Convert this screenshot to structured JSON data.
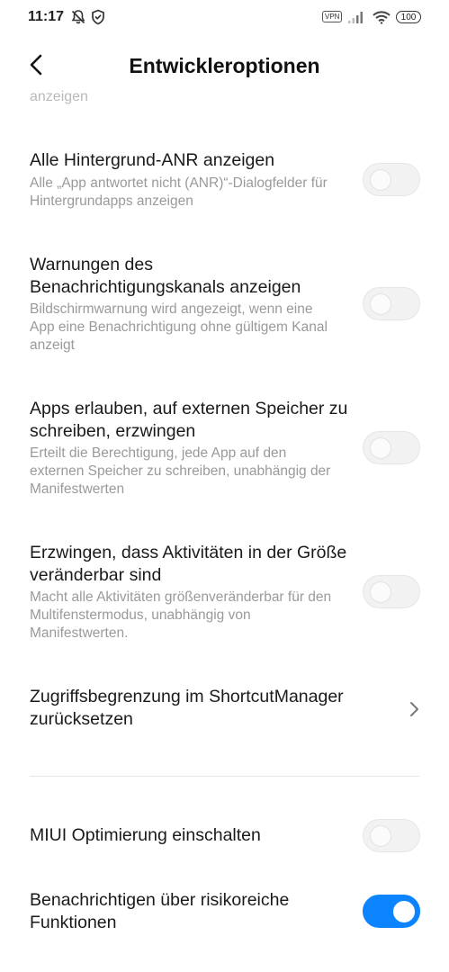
{
  "status_bar": {
    "time": "11:17",
    "vpn": "VPN",
    "battery": "100"
  },
  "header": {
    "title": "Entwickleroptionen"
  },
  "cutoff_text": "anzeigen",
  "items": [
    {
      "title": "Alle Hintergrund-ANR anzeigen",
      "summary": "Alle „App antwortet nicht (ANR)“-Dialogfelder für Hintergrundapps anzeigen",
      "enabled": false
    },
    {
      "title": "Warnungen des Benachrichtigungskanals anzeigen",
      "summary": "Bildschirmwarnung wird angezeigt, wenn eine App eine Benachrichtigung ohne gültigem Kanal anzeigt",
      "enabled": false
    },
    {
      "title": "Apps erlauben, auf externen Speicher zu schreiben, erzwingen",
      "summary": "Erteilt die Berechtigung, jede App auf den externen Speicher zu schreiben, unabhängig der Manifestwerten",
      "enabled": false
    },
    {
      "title": "Erzwingen, dass Aktivitäten in der Größe veränderbar sind",
      "summary": "Macht alle Aktivitäten größenveränderbar für den Multifenstermodus, unabhängig von Manifestwerten.",
      "enabled": false
    },
    {
      "title": "Zugriffsbegrenzung im ShortcutManager zurücksetzen"
    },
    {
      "title": "MIUI Optimierung einschalten",
      "enabled": false
    },
    {
      "title": "Benachrichtigen über risikoreiche Funktionen",
      "enabled": true
    }
  ],
  "colors": {
    "accent": "#0d84ff",
    "summary_text": "#9a9a9a",
    "toggle_off": "#f2f2f2"
  }
}
